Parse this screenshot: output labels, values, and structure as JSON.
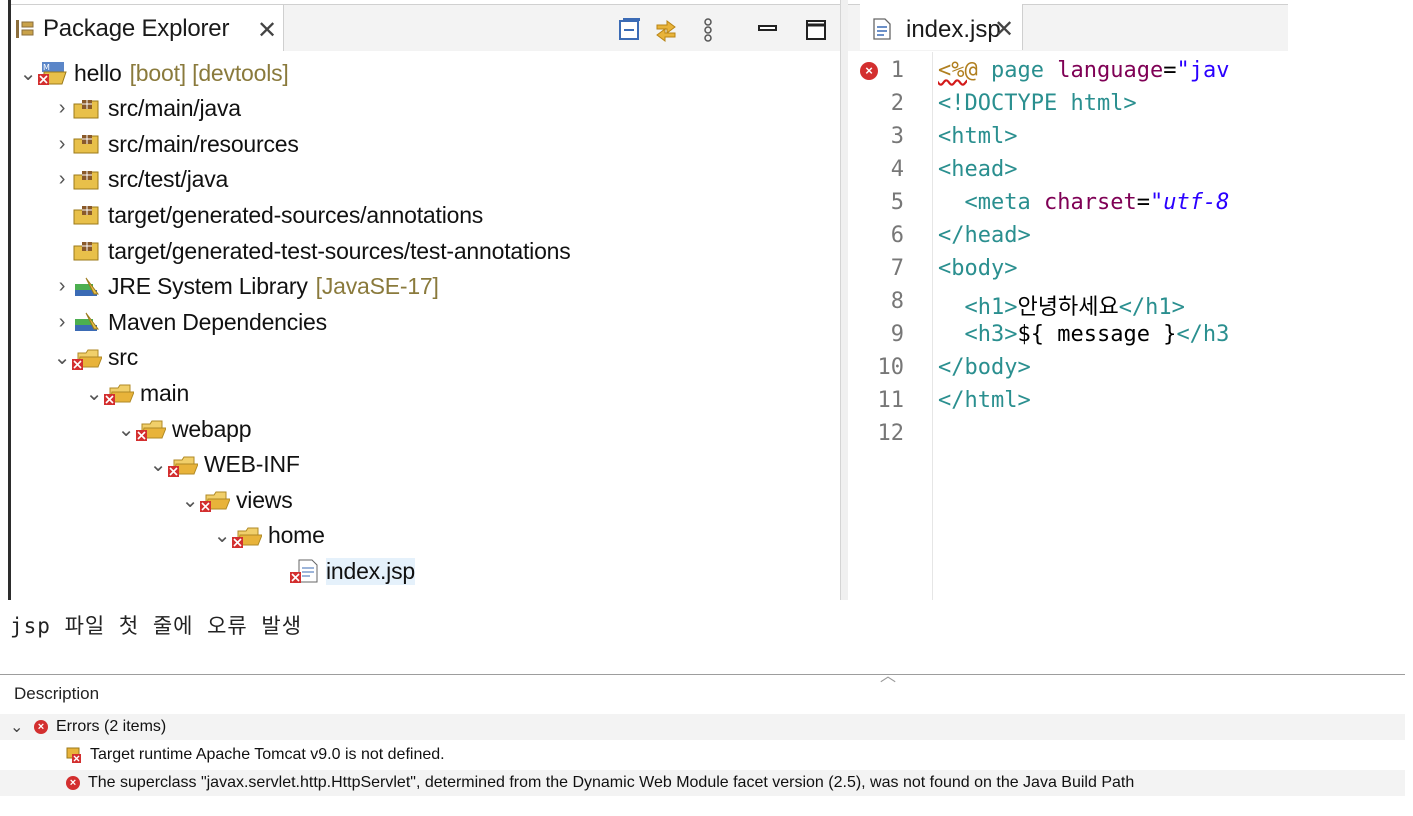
{
  "package_explorer": {
    "tab_title": "Package Explorer",
    "close_glyph": "✕",
    "toolbar_icons": [
      "collapse-all-icon",
      "link-with-editor-icon",
      "view-menu-icon",
      "minimize-icon",
      "maximize-icon"
    ],
    "tree": [
      {
        "label": "hello",
        "decoration": "[boot] [devtools]",
        "chevron": "⌄",
        "icon": "project-icon"
      },
      {
        "label": "src/main/java",
        "chevron": "›",
        "icon": "source-folder-icon"
      },
      {
        "label": "src/main/resources",
        "chevron": "›",
        "icon": "source-folder-icon"
      },
      {
        "label": "src/test/java",
        "chevron": "›",
        "icon": "source-folder-icon"
      },
      {
        "label": "target/generated-sources/annotations",
        "chevron": "",
        "icon": "source-folder-icon"
      },
      {
        "label": "target/generated-test-sources/test-annotations",
        "chevron": "",
        "icon": "source-folder-icon"
      },
      {
        "label": "JRE System Library",
        "decoration": "[JavaSE-17]",
        "chevron": "›",
        "icon": "library-icon"
      },
      {
        "label": "Maven Dependencies",
        "chevron": "›",
        "icon": "library-icon"
      },
      {
        "label": "src",
        "chevron": "⌄",
        "icon": "folder-error-icon"
      },
      {
        "label": "main",
        "chevron": "⌄",
        "icon": "folder-error-icon"
      },
      {
        "label": "webapp",
        "chevron": "⌄",
        "icon": "folder-error-icon"
      },
      {
        "label": "WEB-INF",
        "chevron": "⌄",
        "icon": "folder-error-icon"
      },
      {
        "label": "views",
        "chevron": "⌄",
        "icon": "folder-error-icon"
      },
      {
        "label": "home",
        "chevron": "⌄",
        "icon": "folder-error-icon"
      },
      {
        "label": "index.jsp",
        "chevron": "",
        "icon": "jsp-file-error-icon"
      }
    ]
  },
  "editor": {
    "tab_title": "index.jsp",
    "close_glyph": "✕",
    "line_numbers": [
      "1",
      "2",
      "3",
      "4",
      "5",
      "6",
      "7",
      "8",
      "9",
      "10",
      "11",
      "12"
    ],
    "lines": [
      {
        "parts": [
          [
            "err",
            "<%@"
          ],
          [
            "plain",
            " "
          ],
          [
            "tag",
            "page"
          ],
          [
            "plain",
            " "
          ],
          [
            "attr",
            "language"
          ],
          [
            "plain",
            "="
          ],
          [
            "str",
            "\"jav"
          ]
        ]
      },
      {
        "parts": [
          [
            "tag",
            "<!DOCTYPE html>"
          ]
        ]
      },
      {
        "parts": [
          [
            "tag",
            "<html>"
          ]
        ]
      },
      {
        "parts": [
          [
            "tag",
            "<head>"
          ]
        ]
      },
      {
        "parts": [
          [
            "plain",
            "  "
          ],
          [
            "tag",
            "<meta"
          ],
          [
            "plain",
            " "
          ],
          [
            "attr",
            "charset"
          ],
          [
            "plain",
            "="
          ],
          [
            "stri",
            "\"utf-8"
          ]
        ]
      },
      {
        "parts": [
          [
            "tag",
            "</head>"
          ]
        ]
      },
      {
        "parts": [
          [
            "tag",
            "<body>"
          ]
        ]
      },
      {
        "parts": [
          [
            "plain",
            "  "
          ],
          [
            "tag",
            "<h1>"
          ],
          [
            "plain",
            "안녕하세요"
          ],
          [
            "tag",
            "</h1>"
          ]
        ]
      },
      {
        "parts": [
          [
            "plain",
            "  "
          ],
          [
            "tag",
            "<h3>"
          ],
          [
            "plain",
            "${ message }"
          ],
          [
            "tag",
            "</h3"
          ]
        ]
      },
      {
        "parts": [
          [
            "tag",
            "</body>"
          ]
        ]
      },
      {
        "parts": [
          [
            "tag",
            "</html>"
          ]
        ]
      },
      {
        "parts": []
      }
    ]
  },
  "caption": "jsp 파일 첫 줄에 오류 발생",
  "problems": {
    "column_header": "Description",
    "group_label": "Errors (2 items)",
    "items": [
      {
        "text": "Target runtime Apache Tomcat v9.0 is not defined.",
        "icon": "runtime-error-icon"
      },
      {
        "text": "The superclass \"javax.servlet.http.HttpServlet\", determined from the Dynamic Web Module facet version (2.5), was not found on the Java Build Path",
        "icon": "error-icon"
      }
    ]
  },
  "colors": {
    "tag": "#2a8f8f",
    "attribute": "#7f0055",
    "string": "#2a00ff",
    "error": "#d32f2f",
    "decoration": "#8a7a3c"
  }
}
